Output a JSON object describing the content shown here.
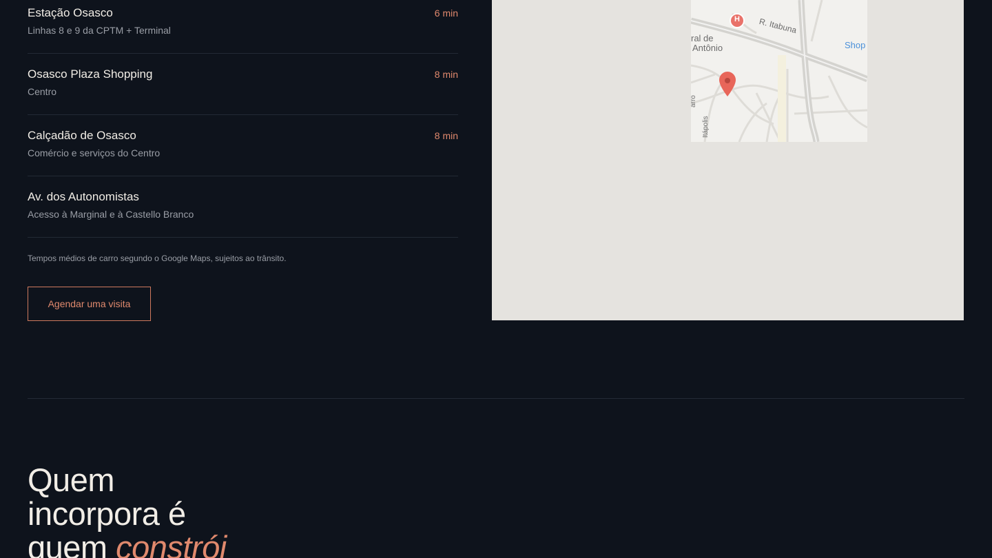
{
  "places": [
    {
      "name": "Estação Osasco",
      "desc": "Linhas 8 e 9 da CPTM + Terminal",
      "time": "6 min"
    },
    {
      "name": "Osasco Plaza Shopping",
      "desc": "Centro",
      "time": "8 min"
    },
    {
      "name": "Calçadão de Osasco",
      "desc": "Comércio e serviços do Centro",
      "time": "8 min"
    },
    {
      "name": "Av. dos Autonomistas",
      "desc": "Acesso à Marginal e à Castello Branco",
      "time": ""
    }
  ],
  "note": "Tempos médios de carro segundo o Google Maps, sujeitos ao trânsito.",
  "cta_label": "Agendar uma visita",
  "map": {
    "labels": {
      "street": "R. Itabuna",
      "area_line1": "ral de",
      "area_line2": "Antônio",
      "shop": "Shop",
      "vertical_street": "Itápolis",
      "vertical_street2": "arro",
      "hospital": "H"
    },
    "colors": {
      "marker": "#e8665a",
      "hospital": "#e9726a",
      "shop_label": "#4a90d9"
    }
  },
  "heading": {
    "line1": "Quem",
    "line2": "incorpora é",
    "line3_plain": "quem",
    "line3_accent": "constrói"
  },
  "colors": {
    "background": "#0e131c",
    "accent": "#e0896d"
  }
}
